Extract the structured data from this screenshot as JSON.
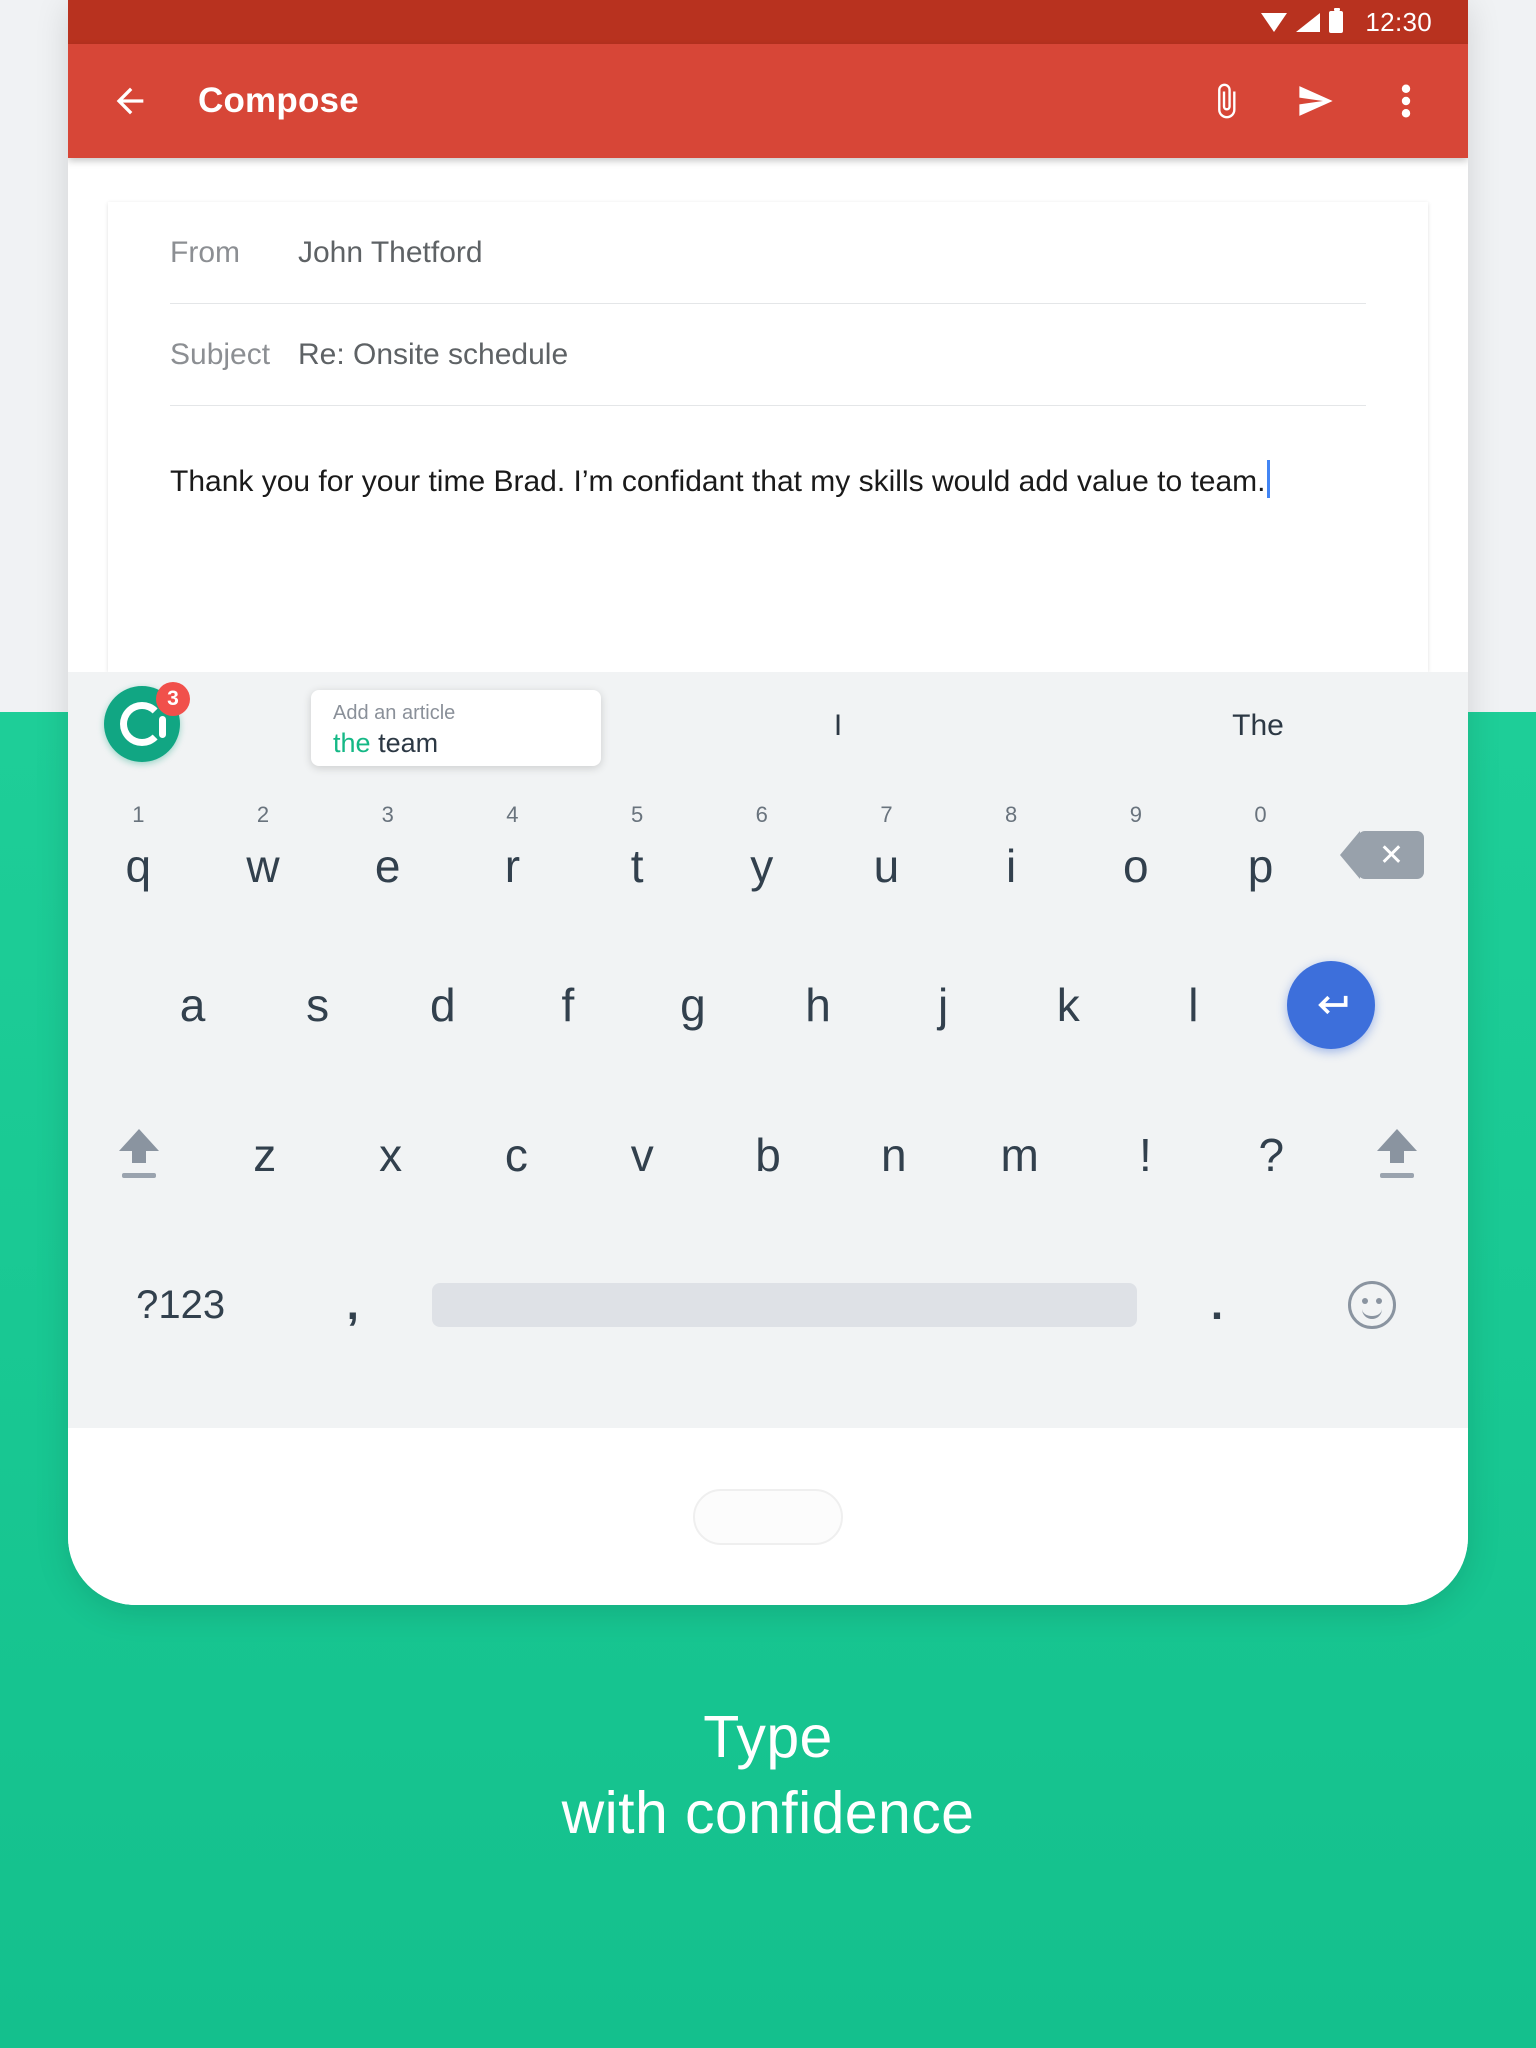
{
  "status_bar": {
    "time": "12:30",
    "icons": [
      "wifi-icon",
      "signal-icon",
      "battery-icon"
    ],
    "background_color": "#B8321F"
  },
  "app_bar": {
    "title": "Compose",
    "back_icon": "back-arrow-icon",
    "attach_icon": "paperclip-icon",
    "send_icon": "send-icon",
    "more_icon": "overflow-menu-icon",
    "background_color": "#D74637"
  },
  "compose": {
    "from_label": "From",
    "from_value": "John Thetford",
    "subject_label": "Subject",
    "subject_value": "Re: Onsite schedule",
    "body_text": "Thank you for your time Brad. I’m confidant that my skills would add value to team.",
    "caret_color": "#4285F4"
  },
  "grammarly": {
    "logo_icon": "grammarly-logo-icon",
    "logo_color": "#11A683",
    "badge_count": "3",
    "badge_color": "#F1504B",
    "suggestion_card": {
      "hint": "Add an article",
      "correction": "the",
      "correction_color": "#15B886",
      "rest": "team"
    }
  },
  "suggestions": {
    "words": [
      "I",
      "The"
    ]
  },
  "keyboard": {
    "row1": [
      {
        "letter": "q",
        "number": "1"
      },
      {
        "letter": "w",
        "number": "2"
      },
      {
        "letter": "e",
        "number": "3"
      },
      {
        "letter": "r",
        "number": "4"
      },
      {
        "letter": "t",
        "number": "5"
      },
      {
        "letter": "y",
        "number": "6"
      },
      {
        "letter": "u",
        "number": "7"
      },
      {
        "letter": "i",
        "number": "8"
      },
      {
        "letter": "o",
        "number": "9"
      },
      {
        "letter": "p",
        "number": "0"
      }
    ],
    "row2": [
      "a",
      "s",
      "d",
      "f",
      "g",
      "h",
      "j",
      "k",
      "l"
    ],
    "row3": [
      "z",
      "x",
      "c",
      "v",
      "b",
      "n",
      "m",
      "!",
      "?"
    ],
    "backspace_icon": "backspace-icon",
    "enter_icon": "enter-key-icon",
    "enter_color": "#3D6FDB",
    "shift_left_icon": "shift-icon",
    "shift_right_icon": "shift-icon",
    "numeric_label": "?123",
    "comma_label": ",",
    "period_label": ".",
    "space_label": "",
    "emoji_icon": "emoji-icon"
  },
  "promo": {
    "line1": "Type",
    "line2": "with confidence",
    "background_color": "#1ECD97"
  }
}
